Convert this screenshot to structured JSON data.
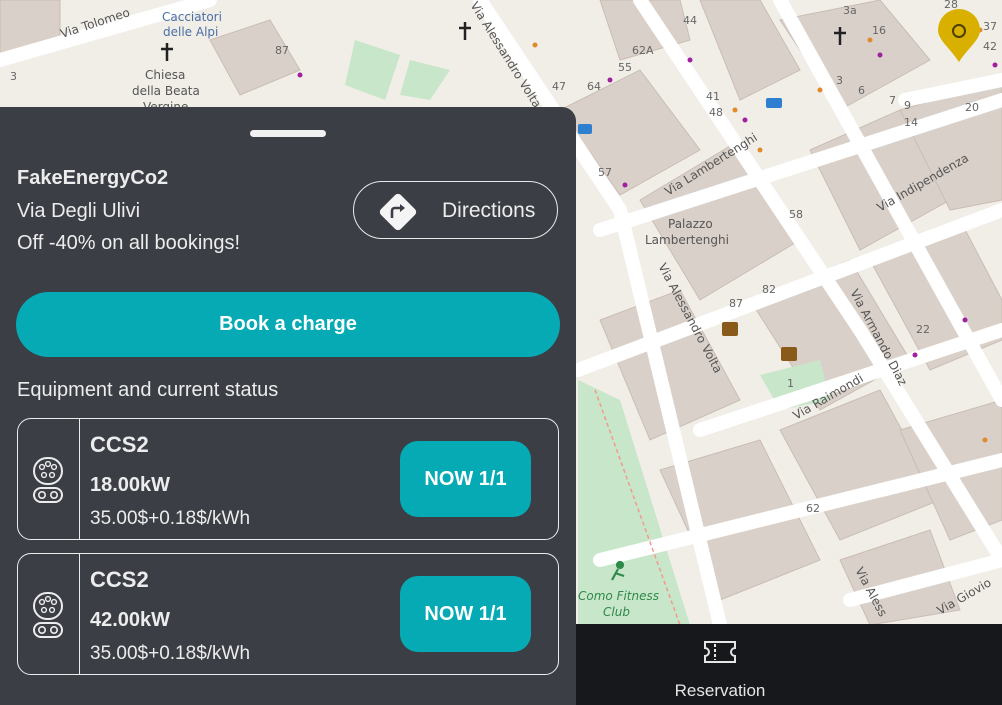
{
  "map": {
    "street_labels": [
      "Via Tolomeo",
      "Via Alessandro Volta",
      "Via Lambertenghi",
      "Via Indipendenza",
      "Via Alessandro Volta",
      "Via Armando Diaz",
      "Via Raimondi",
      "Via Giovio",
      "Via Aless"
    ],
    "poi_labels": [
      "Cacciatori",
      "delle Alpi",
      "Chiesa",
      "della Beata",
      "Vergine",
      "Palazzo",
      "Lambertenghi",
      "Como Fitness",
      "Club"
    ],
    "house_numbers": [
      "87",
      "44",
      "3a",
      "28",
      "16",
      "62A",
      "55",
      "47",
      "64",
      "41",
      "48",
      "3",
      "6",
      "7",
      "9",
      "14",
      "20",
      "37",
      "42",
      "57",
      "58",
      "87",
      "82",
      "22",
      "62",
      "3",
      "1"
    ],
    "colors": {
      "marker": "#d9b000",
      "road": "#ffffff",
      "building": "#d9d0c9",
      "park": "#c8e6c9"
    }
  },
  "panel": {
    "provider": "FakeEnergyCo2",
    "address": "Via Degli Ulivi",
    "promo": "Off -40% on all bookings!",
    "directions_label": "Directions",
    "directions_icon": "directions-icon",
    "book_label": "Book a charge",
    "equipment_title": "Equipment and current status",
    "chargers": [
      {
        "type": "CCS2",
        "power": "18.00kW",
        "price": "35.00$+0.18$/kWh",
        "status": "NOW 1/1",
        "icon": "ccs2-connector-icon"
      },
      {
        "type": "CCS2",
        "power": "42.00kW",
        "price": "35.00$+0.18$/kWh",
        "status": "NOW 1/1",
        "icon": "ccs2-connector-icon"
      }
    ],
    "colors": {
      "accent": "#05aab4",
      "panel_bg": "#3b3f45"
    }
  },
  "tabbar": {
    "reservation_label": "Reservation",
    "reservation_icon": "ticket-icon"
  }
}
